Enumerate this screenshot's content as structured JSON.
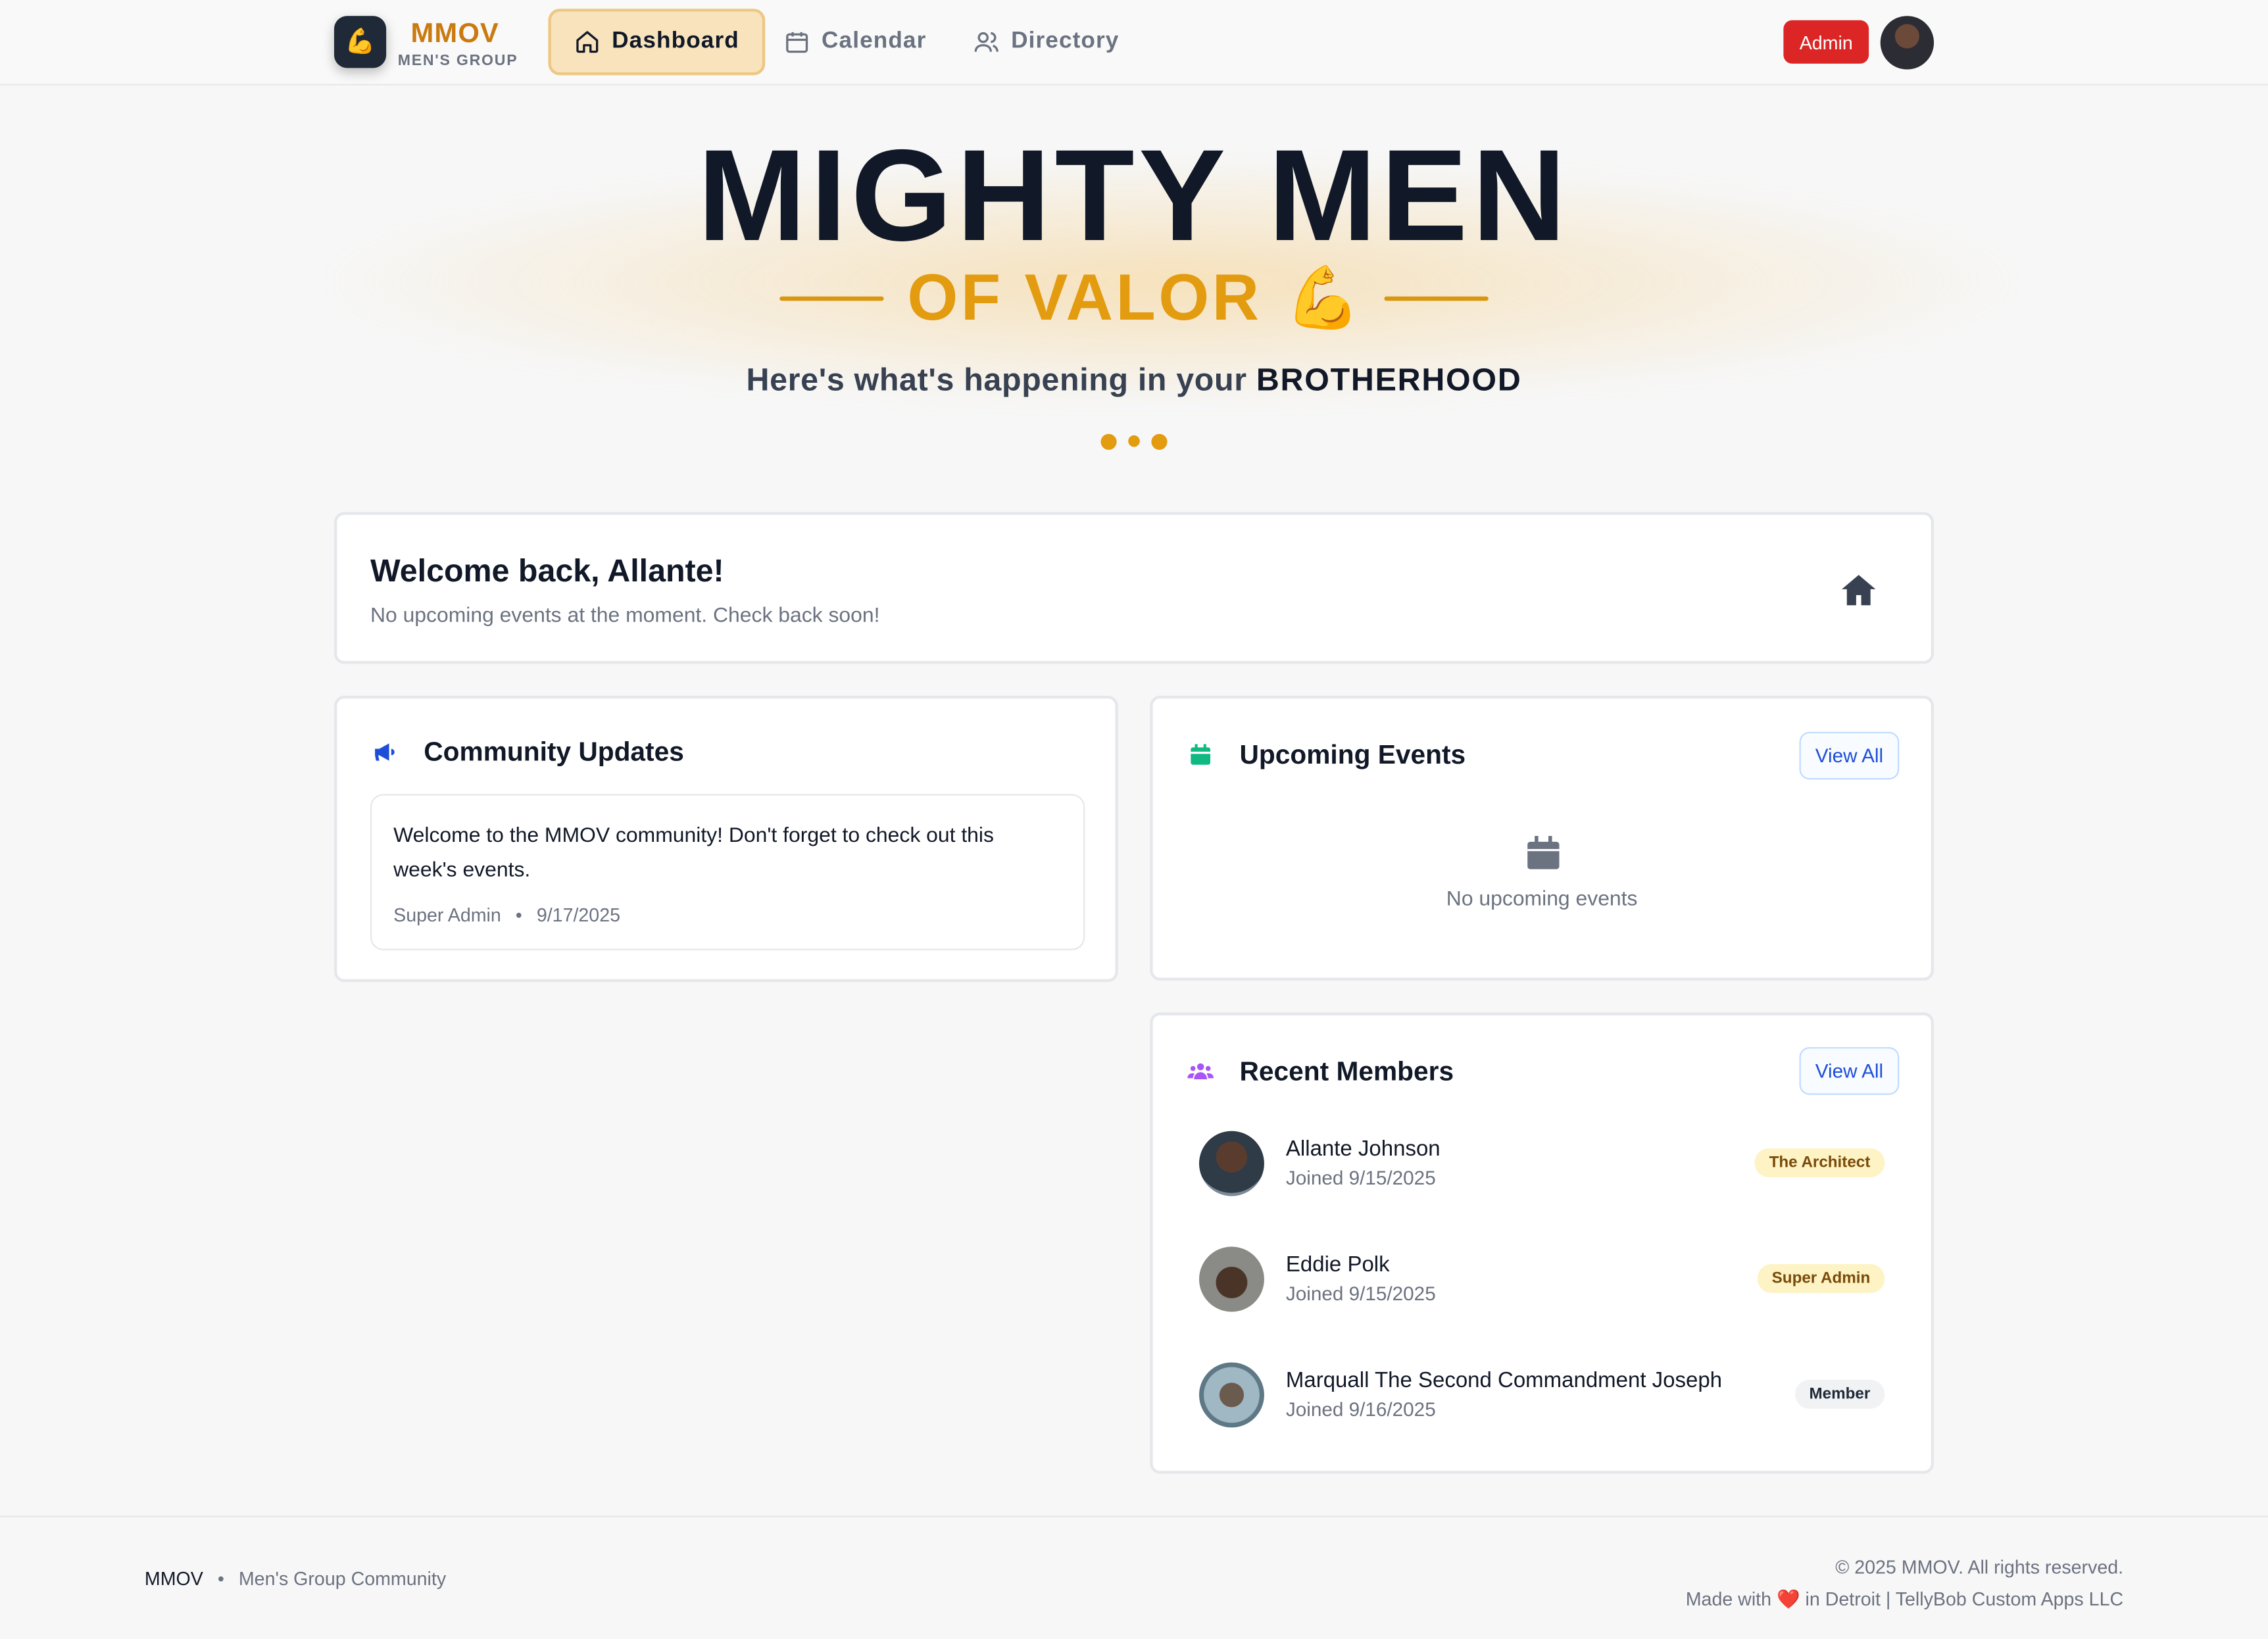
{
  "nav": {
    "logo_emoji": "💪",
    "brand": "MMOV",
    "brand_sub": "MEN'S GROUP",
    "tabs": [
      {
        "label": "Dashboard",
        "icon": "home-icon",
        "active": true
      },
      {
        "label": "Calendar",
        "icon": "calendar-icon",
        "active": false
      },
      {
        "label": "Directory",
        "icon": "users-icon",
        "active": false
      }
    ],
    "admin_label": "Admin"
  },
  "hero": {
    "title": "MIGHTY MEN",
    "subtitle": "OF VALOR",
    "emoji": "💪",
    "tagline_prefix": "Here's what's happening in your ",
    "tagline_bold": "BROTHERHOOD"
  },
  "welcome": {
    "title": "Welcome back, Allante!",
    "message": "No upcoming events at the moment. Check back soon!"
  },
  "updates": {
    "title": "Community Updates",
    "posts": [
      {
        "text": "Welcome to the MMOV community! Don't forget to check out this week's events.",
        "author": "Super Admin",
        "separator": "•",
        "date": "9/17/2025"
      }
    ]
  },
  "events": {
    "title": "Upcoming Events",
    "view_all": "View All",
    "empty": "No upcoming events"
  },
  "members": {
    "title": "Recent Members",
    "view_all": "View All",
    "items": [
      {
        "name": "Allante Johnson",
        "joined": "Joined 9/15/2025",
        "role": "The Architect"
      },
      {
        "name": "Eddie Polk",
        "joined": "Joined 9/15/2025",
        "role": "Super Admin"
      },
      {
        "name": "Marquall The Second Commandment Joseph",
        "joined": "Joined 9/16/2025",
        "role": "Member"
      }
    ]
  },
  "footer": {
    "brand": "MMOV",
    "separator": "•",
    "desc": "Men's Group Community",
    "copyright": "© 2025 MMOV. All rights reserved.",
    "made_prefix": "Made with ",
    "heart": "❤️",
    "made_suffix": " in Detroit | TellyBob Custom Apps LLC"
  },
  "colors": {
    "accent": "#e39b10",
    "brand": "#c97a10",
    "admin": "#dc2626",
    "link": "#1d4ed8"
  }
}
